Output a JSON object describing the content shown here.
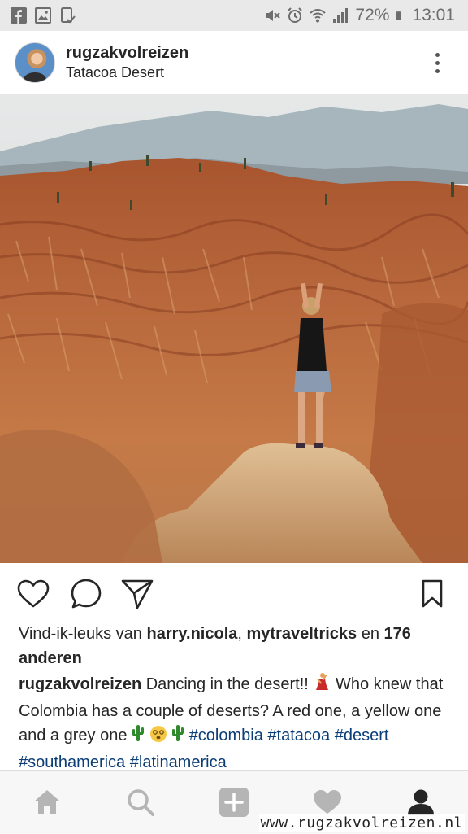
{
  "status_bar": {
    "battery_percent": "72%",
    "time": "13:01",
    "left_icons": [
      "facebook-icon",
      "gallery-icon",
      "tablet-check-icon"
    ],
    "right_icons": [
      "mute-icon",
      "alarm-icon",
      "wifi-icon",
      "signal-icon",
      "battery-icon"
    ]
  },
  "post": {
    "username": "rugzakvolreizen",
    "location": "Tatacoa Desert"
  },
  "likes": {
    "prefix": "Vind-ik-leuks van ",
    "user1": "harry.nicola",
    "separator": ", ",
    "user2": "mytraveltricks",
    "middle": " en ",
    "others": "176 anderen"
  },
  "caption": {
    "username": "rugzakvolreizen",
    "text1": " Dancing in the desert!! ",
    "text2": " Who knew that Colombia has a couple of deserts? A red one, a yellow one and a grey one ",
    "hashtags": [
      "#colombia",
      "#tatacoa",
      "#desert",
      "#southamerica",
      "#latinamerica"
    ]
  },
  "emojis": [
    "dancer-emoji",
    "cactus-emoji",
    "dizzy-face-emoji",
    "cactus-emoji"
  ],
  "bottom_nav": [
    "home-icon",
    "search-icon",
    "add-post-icon",
    "heart-icon",
    "profile-icon"
  ],
  "watermark": "www.rugzakvolreizen.nl",
  "colors": {
    "status_bar_bg": "#e9e9e9",
    "hashtag": "#0b3d77",
    "nav_bg": "#f7f7f7",
    "nav_active": "#262626",
    "nav_inactive": "#b5b5b5"
  }
}
